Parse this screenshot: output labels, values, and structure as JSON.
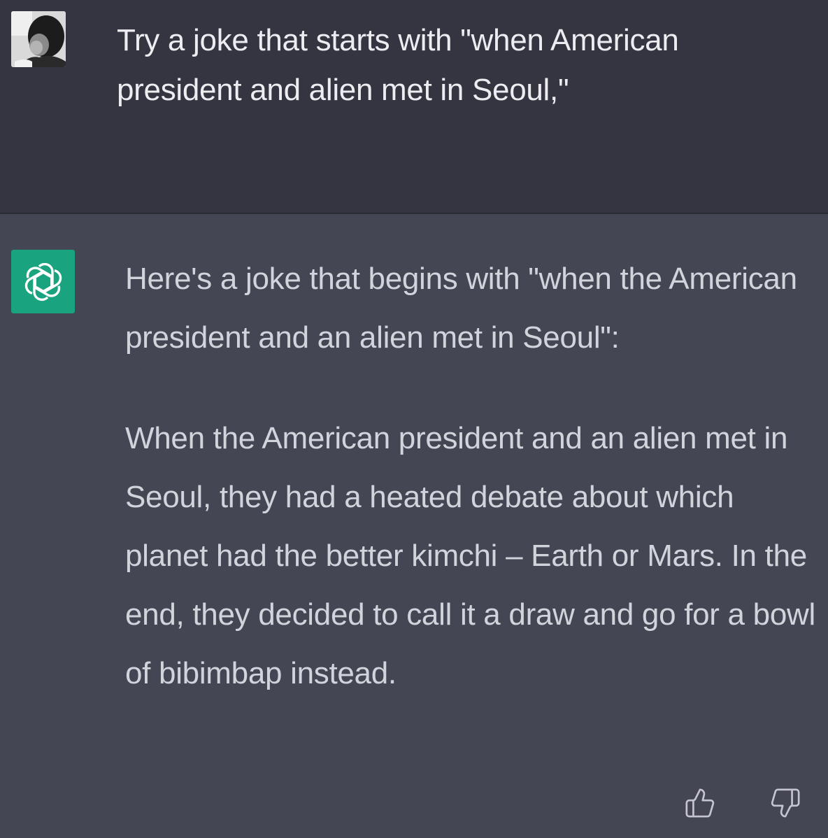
{
  "user_message": {
    "avatar": "user-avatar-photo",
    "text": "Try a joke that starts with \"when American president and alien met in Seoul,\""
  },
  "assistant_message": {
    "avatar": "openai-logo-icon",
    "paragraphs": [
      "Here's a joke that begins with \"when the American president and an alien met in Seoul\":",
      "When the American president and an alien met in Seoul, they had a heated debate about which planet had the better kimchi – Earth or Mars. In the end, they decided to call it a draw and go for a bowl of bibimbap instead."
    ]
  },
  "feedback": {
    "up_icon": "thumbs-up-icon",
    "down_icon": "thumbs-down-icon"
  },
  "colors": {
    "user_bg": "#343541",
    "assistant_bg": "#444654",
    "logo_bg": "#19a37f",
    "text_user": "#ececf1",
    "text_assistant": "#d1d5db"
  }
}
